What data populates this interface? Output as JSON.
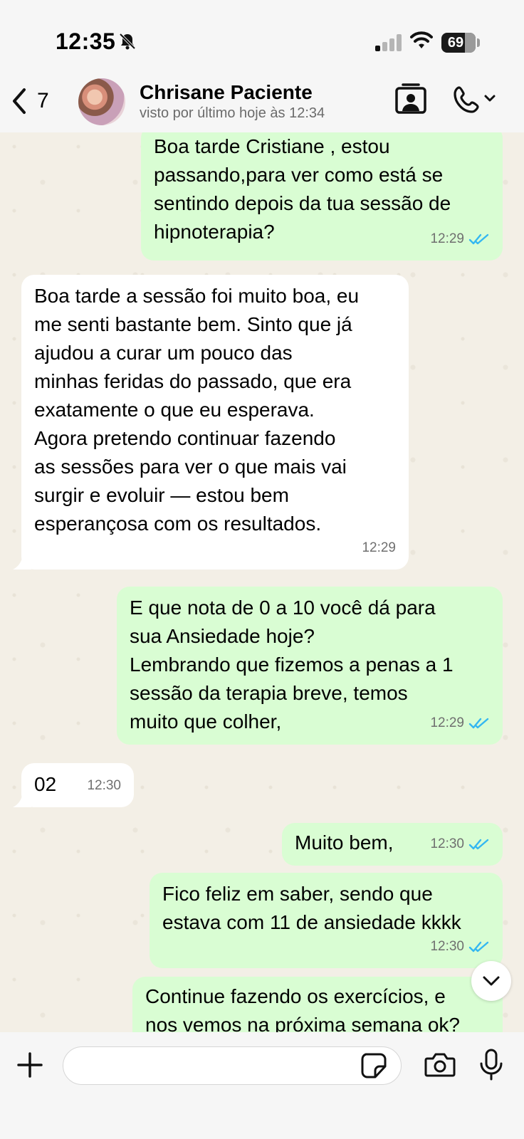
{
  "status_bar": {
    "time": "12:35",
    "battery": "69"
  },
  "header": {
    "back_count": "7",
    "contact_name": "Chrisane Paciente",
    "contact_status": "visto por último hoje às 12:34"
  },
  "messages": [
    {
      "direction": "out",
      "text": "Boa tarde Cristiane , estou\npassando,para ver como está se\nsentindo depois da tua sessão de\nhipnoterapia?",
      "time": "12:29",
      "read": true
    },
    {
      "direction": "in",
      "text": "Boa tarde a sessão foi muito boa, eu\nme senti bastante bem. Sinto que já\najudou a curar um pouco das\nminhas feridas do passado, que era\nexatamente o que eu esperava.\nAgora pretendo continuar fazendo\nas sessões para ver o que mais vai\nsurgir e evoluir — estou bem\nesperançosa com os resultados.",
      "time": "12:29"
    },
    {
      "direction": "out",
      "text": "E que nota de 0 a 10 você dá para\nsua Ansiedade hoje?\nLembrando que fizemos a penas a 1\nsessão da terapia breve, temos\nmuito que colher,",
      "time": "12:29",
      "read": true
    },
    {
      "direction": "in",
      "text": "02",
      "time": "12:30"
    },
    {
      "direction": "out",
      "text": "Muito bem,",
      "time": "12:30",
      "read": true
    },
    {
      "direction": "out",
      "text": "Fico feliz em saber, sendo que\nestava com 11 de ansiedade kkkk",
      "time": "12:30",
      "read": true
    },
    {
      "direction": "out",
      "text": "Continue fazendo os exercícios, e\nnos vemos na próxima semana ok?",
      "time": "",
      "read": false
    }
  ],
  "composer": {
    "placeholder": ""
  },
  "colors": {
    "outgoing_bubble": "#d9fdd3",
    "incoming_bubble": "#ffffff",
    "read_ticks": "#34b7f1"
  }
}
